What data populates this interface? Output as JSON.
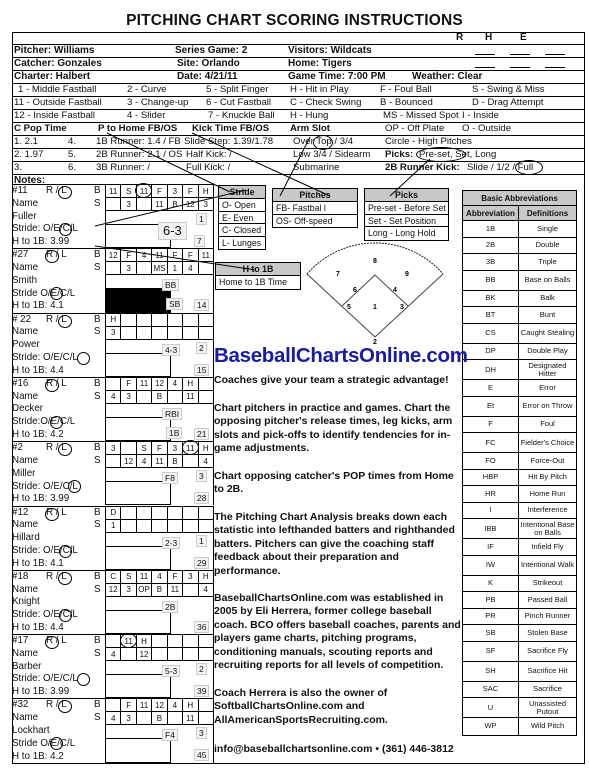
{
  "title": "PITCHING CHART SCORING INSTRUCTIONS",
  "rhe": [
    "R",
    "H",
    "E"
  ],
  "header": {
    "pitcher": "Pitcher:  Williams",
    "catcher": "Catcher: Gonzales",
    "charter": "Charter:  Halbert",
    "series_game": "Series Game:  2",
    "site": "Site:  Orlando",
    "date": "Date:  4/21/11",
    "visitors": "Visitors:  Wildcats",
    "home": "Home:    Tigers",
    "game_time": "Game Time: 7:00 PM",
    "weather": "Weather:  Clear"
  },
  "codes": [
    [
      "1 - Middle Fastball",
      "2 - Curve",
      "5 - Split Finger",
      "H - Hit in Play",
      "F - Foul Ball",
      "S - Swing & Miss"
    ],
    [
      "11 - Outside Fastball",
      "3 - Change-up",
      "6 - Cut Fastball",
      "C - Check Swing",
      "B - Bounced",
      "D - Drag Attempt"
    ],
    [
      "12 - Inside Fastball",
      "4 - Slider",
      "7 - Knuckle Ball",
      "H - Hung",
      "MS - Missed Spot",
      "I - Inside"
    ]
  ],
  "times_header": {
    "pop": "C Pop Time",
    "p_home": "P to Home FB/OS",
    "kick": "Kick Time  FB/OS",
    "arm": "Arm Slot",
    "op": "OP - Off Plate",
    "o": "O - Outside"
  },
  "times_rows": [
    {
      "pop": "1.  2.1",
      "n": "4.",
      "runner": "1B Runner:  1.4 / FB",
      "kick": "Slide Step: 1.39/1.78",
      "arm": "Over Top / 3/4",
      "extra": "Circle - High Pitches"
    },
    {
      "pop": "2.  1.97",
      "n": "5.",
      "runner": "2B Runner:  2.1 / OS",
      "kick": "Half Kick:       /",
      "arm": "Low 3/4 / Sidearm",
      "extra_label": "Picks:",
      "extra": "Pre-set, Set, Long"
    },
    {
      "pop": "3.",
      "n": "6.",
      "runner": "3B Runner:      /",
      "kick": "Full Kick:        /",
      "arm": "Submarine",
      "extra_label": "2B Runner Kick:",
      "extra": "Slide / 1/2 / Full"
    }
  ],
  "notes_label": "Notes:",
  "players": [
    {
      "num": "#11",
      "hand": "R / L",
      "b": "B",
      "s": "S",
      "name_label": "Name",
      "name": "Fuller",
      "stride": "Stride: O/E/C/L",
      "h1b": "H to 1B:  3.99",
      "row1": [
        "11",
        "S",
        "11",
        "F",
        "3",
        "F",
        "H"
      ],
      "row2": [
        "",
        "3",
        "",
        "11",
        "B",
        "12",
        "3"
      ],
      "count_top": "1",
      "count_bot": "7",
      "result": "6-3"
    },
    {
      "num": "#27",
      "hand": "R / L",
      "b": "B",
      "s": "S",
      "name_label": "Name",
      "name": "Smith",
      "stride": "Stride O/E/C/L",
      "h1b": "H to 1B:  4.1",
      "row1": [
        "12",
        "F",
        "4",
        "11",
        "F",
        "F",
        "11"
      ],
      "row2": [
        "",
        "3",
        "",
        "MS",
        "1",
        "4",
        ""
      ],
      "count_top": "",
      "count_bot": "14",
      "result": "BB",
      "result2": "SB"
    },
    {
      "num": "# 22",
      "hand": "R / L",
      "b": "B",
      "s": "S",
      "name_label": "Name",
      "name": "Power",
      "stride": "Stride: O/E/C/L",
      "h1b": "H to 1B:  4.4",
      "row1": [
        "H",
        "",
        "",
        "",
        "",
        "",
        ""
      ],
      "row2": [
        "3",
        "",
        "",
        "",
        "",
        "",
        ""
      ],
      "count_top": "2",
      "count_bot": "15",
      "result": "4-3"
    },
    {
      "num": "#16",
      "hand": "R / L",
      "b": "B",
      "s": "S",
      "name_label": "Name",
      "name": "Decker",
      "stride": "Stride:O/E/C/L",
      "h1b": "H to 1B:  4.2",
      "row1": [
        "",
        "F",
        "11",
        "12",
        "4",
        "H",
        ""
      ],
      "row2": [
        "4",
        "3",
        "",
        "B",
        "",
        "11",
        ""
      ],
      "count_top": "",
      "count_bot": "21",
      "result": "RBI",
      "result2": "1B"
    },
    {
      "num": "#2",
      "hand": "R / L",
      "b": "B",
      "s": "S",
      "name_label": "Name",
      "name": "Miller",
      "stride": "Stride: O/E/C/L",
      "h1b": "H to 1B:  3.99",
      "row1": [
        "3",
        "",
        "S",
        "F",
        "3",
        "11",
        "H"
      ],
      "row2": [
        "",
        "12",
        "4",
        "11",
        "B",
        "",
        "4"
      ],
      "count_top": "3",
      "count_bot": "28",
      "result": "F8"
    },
    {
      "num": "#12",
      "hand": "R / L",
      "b": "B",
      "s": "S",
      "name_label": "Name",
      "name": "Hillard",
      "stride": "Stride: O/E/C/L",
      "h1b": "H to 1B:  4.1",
      "row1": [
        "D",
        "",
        "",
        "",
        "",
        "",
        ""
      ],
      "row2": [
        "1",
        "",
        "",
        "",
        "",
        "",
        ""
      ],
      "count_top": "1",
      "count_bot": "29",
      "result": "2-3"
    },
    {
      "num": "#18",
      "hand": "R / L",
      "b": "B",
      "s": "S",
      "name_label": "Name",
      "name": "Knight",
      "stride": "Stride: O/E/C/L",
      "h1b": "H to 1B:  4.4",
      "row1": [
        "C",
        "S",
        "11",
        "4",
        "F",
        "3",
        "H"
      ],
      "row2": [
        "12",
        "3",
        "OP",
        "B",
        "11",
        "",
        "4"
      ],
      "count_top": "",
      "count_bot": "36",
      "result": "2B"
    },
    {
      "num": "#17",
      "hand": "R / L",
      "b": "B",
      "s": "S",
      "name_label": "Name",
      "name": "Barber",
      "stride": "Stride: O/E/C/L",
      "h1b": "H to 1B:  3.99",
      "row1": [
        "",
        "11",
        "H",
        "",
        "",
        "",
        ""
      ],
      "row2": [
        "4",
        "",
        "12",
        "",
        "",
        "",
        ""
      ],
      "count_top": "2",
      "count_bot": "39",
      "result": "5-3"
    },
    {
      "num": "#32",
      "hand": "R / L",
      "b": "B",
      "s": "S",
      "name_label": "Name",
      "name": "Lockhart",
      "stride": "Stride O/E/C/L",
      "h1b": "H to 1B:  4.2",
      "row1": [
        "",
        "F",
        "11",
        "12",
        "4",
        "H",
        ""
      ],
      "row2": [
        "4",
        "3",
        "",
        "B",
        "",
        "11",
        ""
      ],
      "count_top": "3",
      "count_bot": "45",
      "result": "F4"
    }
  ],
  "legends": {
    "stride": {
      "title": "Stride",
      "items": [
        "O- Open",
        "E- Even",
        "C- Closed",
        "L- Lunges"
      ]
    },
    "pitches": {
      "title": "Pitches",
      "items": [
        "FB- Fastbal l",
        "OS- Off-speed"
      ]
    },
    "picks": {
      "title": "Picks",
      "items": [
        "Pre-set - Before Set",
        "Set - Set Position",
        "Long - Long Hold"
      ]
    },
    "h1b": {
      "title": "H to 1B",
      "items": [
        "Home to 1B Time"
      ]
    }
  },
  "diamond_positions": [
    "1",
    "2",
    "3",
    "4",
    "5",
    "6",
    "7",
    "8",
    "9"
  ],
  "abbreviations": {
    "title": "Basic Abbreviations",
    "col1": "Abbreviation",
    "col2": "Definitions",
    "rows": [
      [
        "1B",
        "Single"
      ],
      [
        "2B",
        "Double"
      ],
      [
        "3B",
        "Triple"
      ],
      [
        "BB",
        "Base on Balls"
      ],
      [
        "BK",
        "Balk"
      ],
      [
        "BT",
        "Bunt"
      ],
      [
        "CS",
        "Caught Stealing"
      ],
      [
        "DP",
        "Double Play"
      ],
      [
        "DH",
        "Designated Hitter"
      ],
      [
        "E",
        "Error"
      ],
      [
        "Et",
        "Error on Throw"
      ],
      [
        "F",
        "Foul"
      ],
      [
        "FC",
        "Fielder's Choice"
      ],
      [
        "FO",
        "Force-Out"
      ],
      [
        "HBP",
        "Hit By Pitch"
      ],
      [
        "HR",
        "Home Run"
      ],
      [
        "I",
        "Interference"
      ],
      [
        "IBB",
        "Intentional Base on Balls"
      ],
      [
        "IF",
        "Infield Fly"
      ],
      [
        "IW",
        "Intentional Walk"
      ],
      [
        "K",
        "Strikeout"
      ],
      [
        "PB",
        "Passed Ball"
      ],
      [
        "PR",
        "Pinch Runner"
      ],
      [
        "SB",
        "Stolen Base"
      ],
      [
        "SF",
        "Sacrifice Fly"
      ],
      [
        "SH",
        "Sacrifice Hit"
      ],
      [
        "SAC",
        "Sacrifice"
      ],
      [
        "U",
        "Unassisted Putout"
      ],
      [
        "WP",
        "Wild Pitch"
      ]
    ]
  },
  "promo": {
    "brand": "BaseballChartsOnline.com",
    "tagline": "Coaches give your team a strategic advantage!",
    "p1_bold": "Chart pitchers in practice and games.  Chart",
    "p1": "the opposing pitcher's release times, leg kicks, arm slots and pick-offs to identify tendencies for in-game adjustments.",
    "p2": "Chart opposing catcher's POP times from Home to 2B.",
    "p3": "The Pitching Chart Analysis breaks down each statistic into lefthanded batters and righthanded batters.  Pitchers can give the coaching staff feedback about their preparation and performance.",
    "p4": "BaseballChartsOnline.com was established in 2005 by Eli Herrera, former college baseball coach.  BCO offers baseball coaches, parents and players game charts, pitching programs, conditioning manuals, scouting reports and recruiting reports for all levels of competition.",
    "p5": "Coach Herrera is also the owner of SoftballChartsOnline.com and AllAmericanSportsRecruiting.com.",
    "contact": "info@baseballchartsonline.com • (361) 446-3812"
  }
}
